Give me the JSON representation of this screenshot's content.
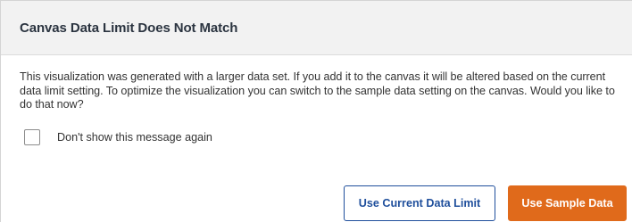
{
  "dialog": {
    "title": "Canvas Data Limit Does Not Match",
    "message": "This visualization was generated with a larger data set. If you add it to the canvas it will be altered based on the current data limit setting. To optimize the visualization you can switch to the sample data setting on the canvas. Would you like to do that now?",
    "checkbox_label": "Don't show this message again",
    "checkbox_checked": false,
    "buttons": {
      "secondary_label": "Use Current Data Limit",
      "primary_label": "Use Sample Data"
    }
  },
  "colors": {
    "primary_button": "#e06a1b",
    "secondary_button_border": "#1f4f9c",
    "header_background": "#f2f2f2"
  }
}
